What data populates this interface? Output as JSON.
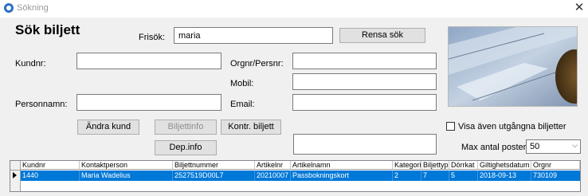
{
  "window": {
    "title": "Sökning",
    "close_glyph": "✕"
  },
  "heading": "Sök biljett",
  "search": {
    "frisok_label": "Frisök:",
    "frisok_value": "maria",
    "rensa_label": "Rensa sök",
    "kundnr_label": "Kundnr:",
    "kundnr_value": "",
    "personnamn_label": "Personnamn:",
    "personnamn_value": "",
    "orgnr_label": "Orgnr/Persnr:",
    "orgnr_value": "",
    "mobil_label": "Mobil:",
    "mobil_value": "",
    "email_label": "Email:",
    "email_value": "",
    "extra_value": ""
  },
  "buttons": {
    "andra_kund": "Ändra kund",
    "biljettinfo": "Biljettinfo",
    "kontr_biljett": "Kontr. biljett",
    "dep_info": "Dep.info"
  },
  "options": {
    "show_expired_label": "Visa även utgångna biljetter",
    "show_expired_checked": false,
    "max_rows_label": "Max antal poster:",
    "max_rows_value": "50"
  },
  "grid": {
    "columns": [
      "Kundnr",
      "Kontaktperson",
      "Biljettnummer",
      "Artikelnr",
      "Artikelnamn",
      "Kategori",
      "Biljettyp",
      "Dörrkat",
      "Giltighetsdatum",
      "Orgnr"
    ],
    "rows": [
      [
        "1440",
        "Maria Wadelius",
        "2527519D00L7",
        "20210007",
        "Passbokningskort",
        "2",
        "7",
        "5",
        "2018-09-13",
        "730109"
      ]
    ]
  },
  "colors": {
    "selection": "#0078d7",
    "window_bg": "#f0f0f0"
  },
  "icons": {
    "app": "app-icon",
    "close": "close-icon",
    "dropdown": "chevron-down-icon",
    "current_row": "row-pointer-icon"
  }
}
